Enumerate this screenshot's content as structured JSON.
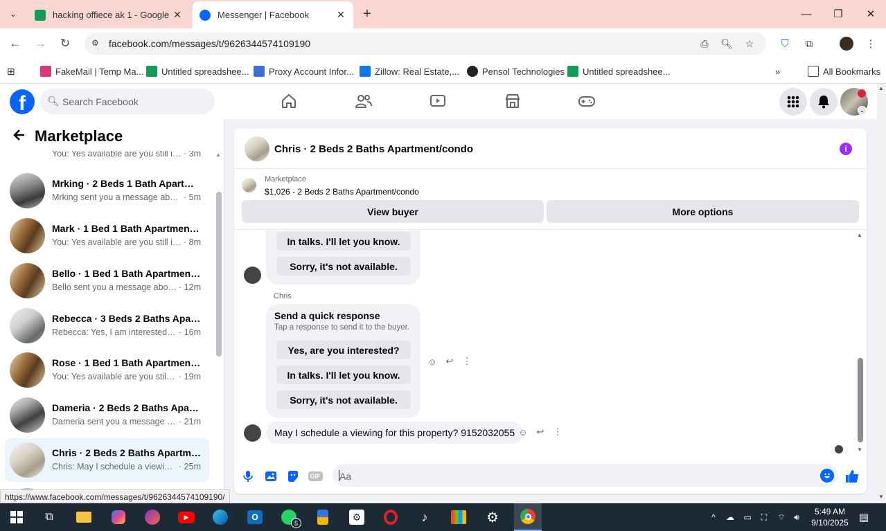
{
  "browser": {
    "tabs": [
      {
        "title": "hacking offiece ak 1 - Google Sl",
        "active": false
      },
      {
        "title": "Messenger | Facebook",
        "active": true
      }
    ],
    "url": "facebook.com/messages/t/9626344574109190",
    "bookmarks": [
      {
        "label": "FakeMail | Temp Ma...",
        "icon": "fakemail-icon"
      },
      {
        "label": "Untitled spreadshee...",
        "icon": "sheets-icon"
      },
      {
        "label": "Proxy Account Infor...",
        "icon": "proxy-icon"
      },
      {
        "label": "Zillow: Real Estate,...",
        "icon": "zillow-icon"
      },
      {
        "label": "Pensol Technologies",
        "icon": "pensol-icon"
      },
      {
        "label": "Untitled spreadshee...",
        "icon": "sheets-icon"
      }
    ],
    "all_bookmarks": "All Bookmarks",
    "status_url": "https://www.facebook.com/messages/t/9626344574109190/"
  },
  "facebook": {
    "search_placeholder": "Search Facebook"
  },
  "sidebar": {
    "title": "Marketplace",
    "conversations": [
      {
        "name": "",
        "preview": "You: Yes available are you still inter...",
        "time": "3m",
        "selected": false
      },
      {
        "name": "Mrking · 2 Beds 1 Bath Apartme...",
        "preview": "Mrking sent you a message about ...",
        "time": "5m",
        "selected": false
      },
      {
        "name": "Mark · 1 Bed 1 Bath Apartment/...",
        "preview": "You: Yes available are you still inter...",
        "time": "8m",
        "selected": false
      },
      {
        "name": "Bello · 1 Bed 1 Bath Apartment/c...",
        "preview": "Bello sent you a message about ...",
        "time": "12m",
        "selected": false
      },
      {
        "name": "Rebecca · 3 Beds 2 Baths Apart...",
        "preview": "Rebecca: Yes, I am interested. My...",
        "time": "16m",
        "selected": false
      },
      {
        "name": "Rose · 1 Bed 1 Bath Apartment/c...",
        "preview": "You: Yes available are you still int...",
        "time": "19m",
        "selected": false
      },
      {
        "name": "Dameria · 2 Beds 2 Baths Apart...",
        "preview": "Dameria sent you a message abo...",
        "time": "21m",
        "selected": false
      },
      {
        "name": "Chris · 2 Beds 2 Baths Apartmen...",
        "preview": "Chris: May I schedule a viewing f...",
        "time": "25m",
        "selected": true
      }
    ]
  },
  "chat": {
    "title": "Chris · 2 Beds 2 Baths Apartment/condo",
    "listing_source": "Marketplace",
    "listing_title": "$1,026 - 2 Beds 2 Baths Apartment/condo",
    "view_buyer": "View buyer",
    "more_options": "More options",
    "quick_response_top": [
      "In talks. I'll let you know.",
      "Sorry, it's not available."
    ],
    "sender": "Chris",
    "quick_response": {
      "heading": "Send a quick response",
      "sub": "Tap a response to send it to the buyer.",
      "options": [
        "Yes, are you interested?",
        "In talks. I'll let you know.",
        "Sorry, it's not available."
      ]
    },
    "last_message": "May I schedule a viewing for this property? 9152032055",
    "composer_placeholder": "Aa"
  },
  "taskbar": {
    "time": "5:49 AM",
    "date": "9/10/2025",
    "whatsapp_badge": "5"
  },
  "colors": {
    "facebook_blue": "#0866ff",
    "tabbar": "#f9d6d2",
    "selected_conv": "#ebf5ff",
    "info_purple": "#9b30ff"
  }
}
